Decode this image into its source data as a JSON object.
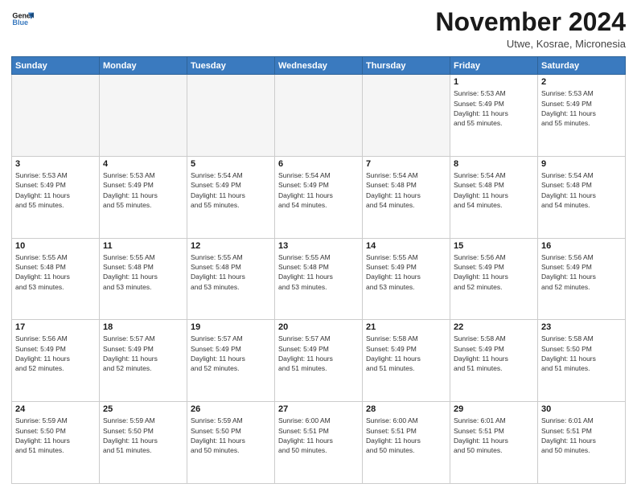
{
  "header": {
    "logo_line1": "General",
    "logo_line2": "Blue",
    "month_title": "November 2024",
    "subtitle": "Utwe, Kosrae, Micronesia"
  },
  "days_of_week": [
    "Sunday",
    "Monday",
    "Tuesday",
    "Wednesday",
    "Thursday",
    "Friday",
    "Saturday"
  ],
  "weeks": [
    [
      {
        "day": "",
        "info": ""
      },
      {
        "day": "",
        "info": ""
      },
      {
        "day": "",
        "info": ""
      },
      {
        "day": "",
        "info": ""
      },
      {
        "day": "",
        "info": ""
      },
      {
        "day": "1",
        "info": "Sunrise: 5:53 AM\nSunset: 5:49 PM\nDaylight: 11 hours\nand 55 minutes."
      },
      {
        "day": "2",
        "info": "Sunrise: 5:53 AM\nSunset: 5:49 PM\nDaylight: 11 hours\nand 55 minutes."
      }
    ],
    [
      {
        "day": "3",
        "info": "Sunrise: 5:53 AM\nSunset: 5:49 PM\nDaylight: 11 hours\nand 55 minutes."
      },
      {
        "day": "4",
        "info": "Sunrise: 5:53 AM\nSunset: 5:49 PM\nDaylight: 11 hours\nand 55 minutes."
      },
      {
        "day": "5",
        "info": "Sunrise: 5:54 AM\nSunset: 5:49 PM\nDaylight: 11 hours\nand 55 minutes."
      },
      {
        "day": "6",
        "info": "Sunrise: 5:54 AM\nSunset: 5:49 PM\nDaylight: 11 hours\nand 54 minutes."
      },
      {
        "day": "7",
        "info": "Sunrise: 5:54 AM\nSunset: 5:48 PM\nDaylight: 11 hours\nand 54 minutes."
      },
      {
        "day": "8",
        "info": "Sunrise: 5:54 AM\nSunset: 5:48 PM\nDaylight: 11 hours\nand 54 minutes."
      },
      {
        "day": "9",
        "info": "Sunrise: 5:54 AM\nSunset: 5:48 PM\nDaylight: 11 hours\nand 54 minutes."
      }
    ],
    [
      {
        "day": "10",
        "info": "Sunrise: 5:55 AM\nSunset: 5:48 PM\nDaylight: 11 hours\nand 53 minutes."
      },
      {
        "day": "11",
        "info": "Sunrise: 5:55 AM\nSunset: 5:48 PM\nDaylight: 11 hours\nand 53 minutes."
      },
      {
        "day": "12",
        "info": "Sunrise: 5:55 AM\nSunset: 5:48 PM\nDaylight: 11 hours\nand 53 minutes."
      },
      {
        "day": "13",
        "info": "Sunrise: 5:55 AM\nSunset: 5:48 PM\nDaylight: 11 hours\nand 53 minutes."
      },
      {
        "day": "14",
        "info": "Sunrise: 5:55 AM\nSunset: 5:49 PM\nDaylight: 11 hours\nand 53 minutes."
      },
      {
        "day": "15",
        "info": "Sunrise: 5:56 AM\nSunset: 5:49 PM\nDaylight: 11 hours\nand 52 minutes."
      },
      {
        "day": "16",
        "info": "Sunrise: 5:56 AM\nSunset: 5:49 PM\nDaylight: 11 hours\nand 52 minutes."
      }
    ],
    [
      {
        "day": "17",
        "info": "Sunrise: 5:56 AM\nSunset: 5:49 PM\nDaylight: 11 hours\nand 52 minutes."
      },
      {
        "day": "18",
        "info": "Sunrise: 5:57 AM\nSunset: 5:49 PM\nDaylight: 11 hours\nand 52 minutes."
      },
      {
        "day": "19",
        "info": "Sunrise: 5:57 AM\nSunset: 5:49 PM\nDaylight: 11 hours\nand 52 minutes."
      },
      {
        "day": "20",
        "info": "Sunrise: 5:57 AM\nSunset: 5:49 PM\nDaylight: 11 hours\nand 51 minutes."
      },
      {
        "day": "21",
        "info": "Sunrise: 5:58 AM\nSunset: 5:49 PM\nDaylight: 11 hours\nand 51 minutes."
      },
      {
        "day": "22",
        "info": "Sunrise: 5:58 AM\nSunset: 5:49 PM\nDaylight: 11 hours\nand 51 minutes."
      },
      {
        "day": "23",
        "info": "Sunrise: 5:58 AM\nSunset: 5:50 PM\nDaylight: 11 hours\nand 51 minutes."
      }
    ],
    [
      {
        "day": "24",
        "info": "Sunrise: 5:59 AM\nSunset: 5:50 PM\nDaylight: 11 hours\nand 51 minutes."
      },
      {
        "day": "25",
        "info": "Sunrise: 5:59 AM\nSunset: 5:50 PM\nDaylight: 11 hours\nand 51 minutes."
      },
      {
        "day": "26",
        "info": "Sunrise: 5:59 AM\nSunset: 5:50 PM\nDaylight: 11 hours\nand 50 minutes."
      },
      {
        "day": "27",
        "info": "Sunrise: 6:00 AM\nSunset: 5:51 PM\nDaylight: 11 hours\nand 50 minutes."
      },
      {
        "day": "28",
        "info": "Sunrise: 6:00 AM\nSunset: 5:51 PM\nDaylight: 11 hours\nand 50 minutes."
      },
      {
        "day": "29",
        "info": "Sunrise: 6:01 AM\nSunset: 5:51 PM\nDaylight: 11 hours\nand 50 minutes."
      },
      {
        "day": "30",
        "info": "Sunrise: 6:01 AM\nSunset: 5:51 PM\nDaylight: 11 hours\nand 50 minutes."
      }
    ]
  ]
}
